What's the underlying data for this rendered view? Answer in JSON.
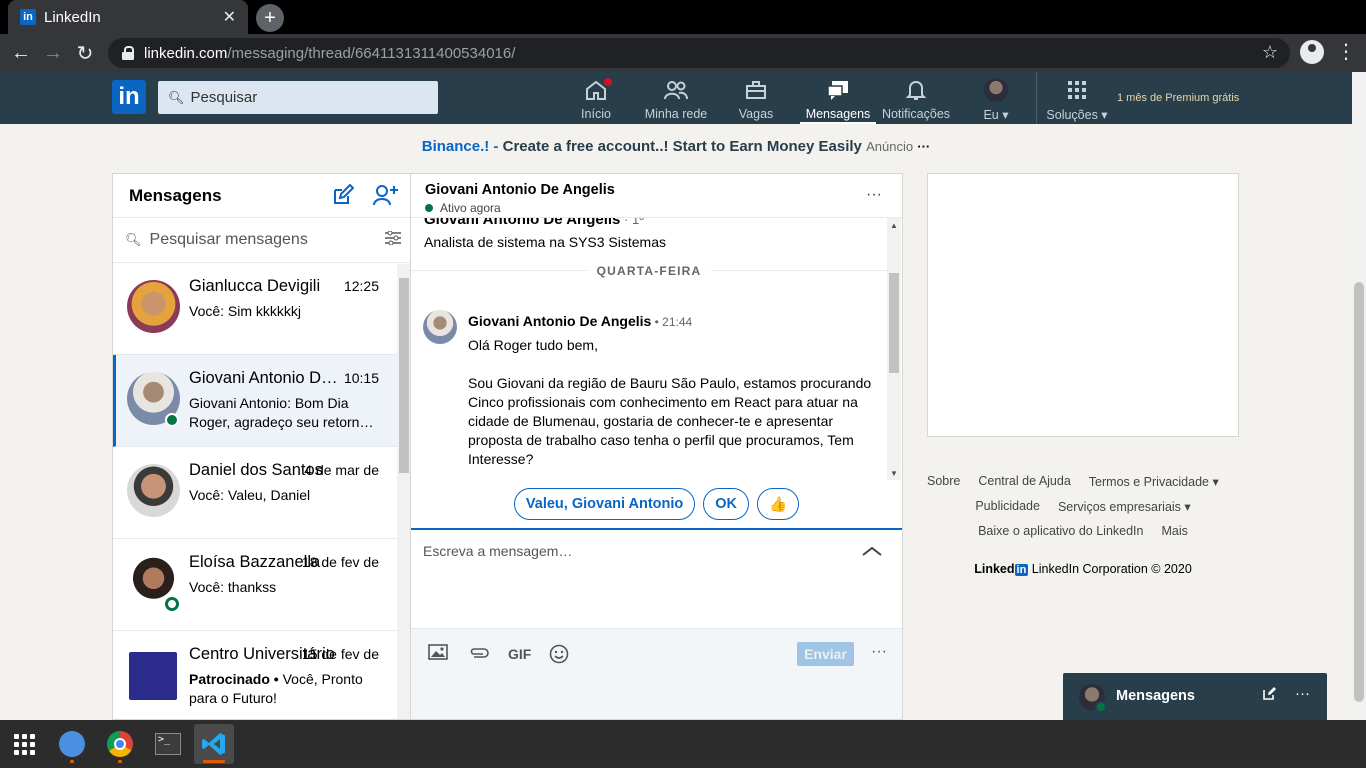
{
  "browser": {
    "tab_title": "LinkedIn",
    "tab_close": "✕",
    "new_tab": "+",
    "url_host": "linkedin.com",
    "url_path": "/messaging/thread/6641131311400534016/"
  },
  "header": {
    "logo": "in",
    "search_placeholder": "Pesquisar",
    "nav": [
      {
        "label": "Início",
        "icon": "home-icon"
      },
      {
        "label": "Minha rede",
        "icon": "network-icon"
      },
      {
        "label": "Vagas",
        "icon": "briefcase-icon"
      },
      {
        "label": "Mensagens",
        "icon": "messages-icon"
      },
      {
        "label": "Notificações",
        "icon": "bell-icon"
      },
      {
        "label": "Eu ▾",
        "icon": "avatar"
      },
      {
        "label": "Soluções ▾",
        "icon": "grid-icon"
      }
    ],
    "premium": "1 mês de Premium grátis"
  },
  "ad": {
    "brand": "Binance.!",
    "sep": " - ",
    "text": "Create a free account..! Start to Earn Money Easily",
    "tag": "Anúncio",
    "more": "···"
  },
  "list": {
    "title": "Mensagens",
    "search_placeholder": "Pesquisar mensagens",
    "conversations": [
      {
        "name": "Gianlucca Devigili",
        "time": "12:25",
        "snippet": "Você: Sim kkkkkkj"
      },
      {
        "name": "Giovani Antonio De Angelis",
        "time": "10:15",
        "snippet": "Giovani Antonio: Bom Dia Roger, agradeço seu retorn…"
      },
      {
        "name": "Daniel dos Santos",
        "time": "4 de mar de",
        "snippet": "Você: Valeu, Daniel"
      },
      {
        "name": "Eloísa Bazzanella",
        "time": "18 de fev de",
        "snippet": "Você: thankss"
      },
      {
        "name": "Centro Universitário",
        "time": "15 de fev de",
        "sponsored": "Patrocinado •",
        "snippet": " Você, Pronto para o Futuro!"
      }
    ]
  },
  "thread": {
    "name": "Giovani Antonio De Angelis",
    "status": "Ativo agora",
    "more": "···",
    "profile_name": "Giovani Antonio De Angelis",
    "profile_degree": " · 1º",
    "profile_headline": "Analista de sistema na SYS3 Sistemas",
    "day_label": "QUARTA-FEIRA",
    "message": {
      "sender": "Giovani Antonio De Angelis",
      "time": " • 21:44",
      "para1": "Olá Roger tudo bem,",
      "para2": "Sou Giovani da região de Bauru São Paulo, estamos procurando Cinco profissionais com conhecimento em React para atuar na cidade de Blumenau, gostaria de conhecer-te e apresentar proposta de trabalho caso tenha o perfil que procuramos, Tem Interesse?"
    },
    "quick_replies": [
      "Valeu, Giovani Antonio",
      "OK",
      "👍"
    ],
    "compose_placeholder": "Escreva a mensagem…",
    "gif": "GIF",
    "send": "Enviar",
    "more2": "···"
  },
  "footer": {
    "row1": [
      "Sobre",
      "Central de Ajuda",
      "Termos e Privacidade ▾"
    ],
    "row2": [
      "Publicidade",
      "Serviços empresariais ▾"
    ],
    "row3": [
      "Baixe o aplicativo do LinkedIn",
      "Mais"
    ],
    "brand_text": "Linked",
    "brand_in": "in",
    "copyright": " LinkedIn Corporation © 2020"
  },
  "overlay": {
    "title": "Mensagens",
    "more": "···"
  },
  "colors": {
    "brand": "#0a66c2",
    "header_bg": "#283e4a",
    "online": "#057642"
  }
}
